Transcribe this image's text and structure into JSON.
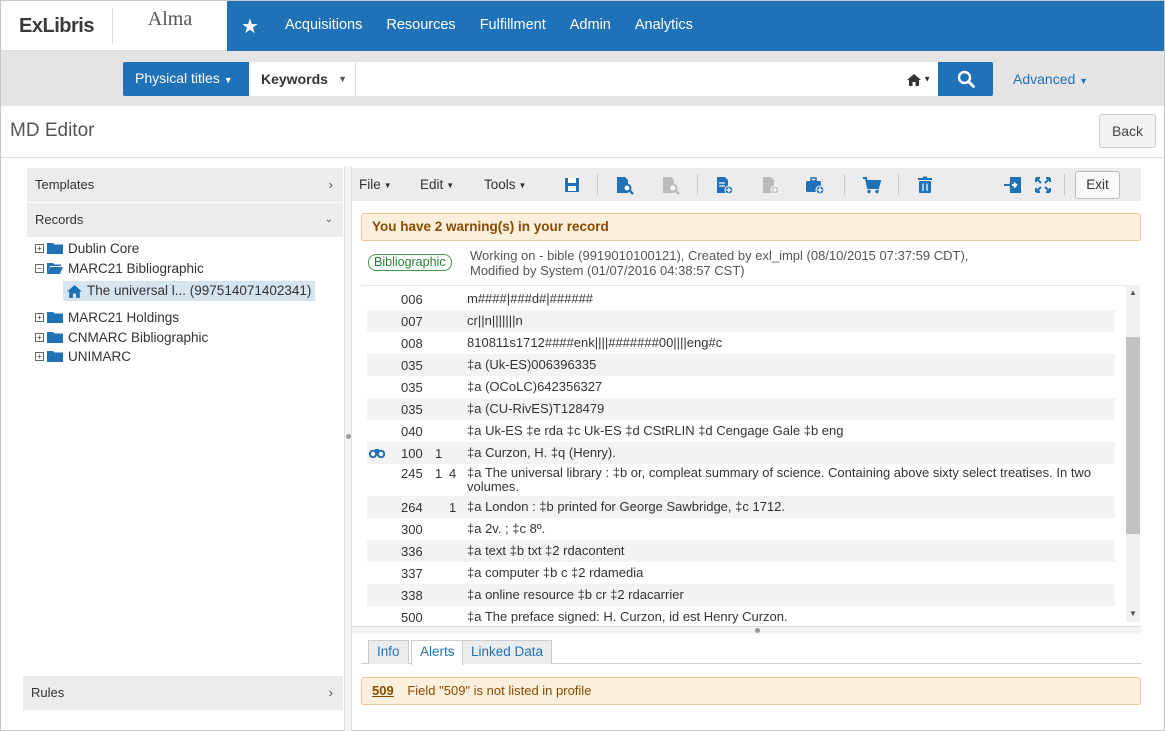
{
  "brand": {
    "company": "ExLibris",
    "product": "Alma"
  },
  "nav": {
    "items": [
      "Acquisitions",
      "Resources",
      "Fulfillment",
      "Admin",
      "Analytics"
    ]
  },
  "search": {
    "scope": "Physical titles",
    "field": "Keywords",
    "value": "",
    "advanced": "Advanced"
  },
  "page": {
    "title": "MD Editor",
    "back": "Back"
  },
  "left": {
    "templates": "Templates",
    "records": "Records",
    "rules": "Rules",
    "tree": {
      "dublin": "Dublin Core",
      "marc21bib": "MARC21 Bibliographic",
      "record": "The universal l... (997514071402341)",
      "holdings": "MARC21 Holdings",
      "cnmarc": "CNMARC Bibliographic",
      "unimarc": "UNIMARC"
    }
  },
  "toolbar": {
    "file": "File",
    "edit": "Edit",
    "tools": "Tools",
    "exit": "Exit"
  },
  "warning": "You have 2 warning(s) in your record",
  "record_info": {
    "badge": "Bibliographic",
    "line1": "Working on - bible (9919010100121), Created by exl_impl (08/10/2015 07:37:59 CDT),",
    "line2": "Modified by System (01/07/2016 04:38:57 CST)"
  },
  "marc": [
    {
      "tag": "006",
      "i1": "",
      "i2": "",
      "value": "m####|###d#|######"
    },
    {
      "tag": "007",
      "i1": "",
      "i2": "",
      "value": "cr||n|||||||n"
    },
    {
      "tag": "008",
      "i1": "",
      "i2": "",
      "value": "810811s1712####enk||||#######00||||eng#c"
    },
    {
      "tag": "035",
      "i1": "",
      "i2": "",
      "value": "‡a (Uk-ES)006396335"
    },
    {
      "tag": "035",
      "i1": "",
      "i2": "",
      "value": "‡a (OCoLC)642356327"
    },
    {
      "tag": "035",
      "i1": "",
      "i2": "",
      "value": "‡a (CU-RivES)T128479"
    },
    {
      "tag": "040",
      "i1": "",
      "i2": "",
      "value": "‡a Uk-ES ‡e rda ‡c Uk-ES ‡d CStRLIN ‡d Cengage Gale ‡b eng"
    },
    {
      "tag": "100",
      "i1": "1",
      "i2": "",
      "value": "‡a Curzon, H. ‡q (Henry)."
    },
    {
      "tag": "245",
      "i1": "1",
      "i2": "4",
      "value": "‡a The universal library : ‡b or, compleat summary of science. Containing above sixty select treatises. In two volumes."
    },
    {
      "tag": "264",
      "i1": "",
      "i2": "1",
      "value": "‡a London : ‡b printed for George Sawbridge, ‡c 1712."
    },
    {
      "tag": "300",
      "i1": "",
      "i2": "",
      "value": "‡a 2v. ; ‡c 8º."
    },
    {
      "tag": "336",
      "i1": "",
      "i2": "",
      "value": "‡a text ‡b txt ‡2 rdacontent"
    },
    {
      "tag": "337",
      "i1": "",
      "i2": "",
      "value": "‡a computer ‡b c ‡2 rdamedia"
    },
    {
      "tag": "338",
      "i1": "",
      "i2": "",
      "value": "‡a online resource ‡b cr ‡2 rdacarrier"
    },
    {
      "tag": "500",
      "i1": "",
      "i2": "",
      "value": "‡a The preface signed: H. Curzon, id est Henry Curzon."
    }
  ],
  "tabs": [
    "Info",
    "Alerts",
    "Linked Data"
  ],
  "alert": {
    "code": "509",
    "message": "Field \"509\" is not listed in profile"
  },
  "colors": {
    "brand_blue": "#1f71b8",
    "warning_bg": "#fcefdc",
    "badge_green": "#3e9a48"
  },
  "icons": {
    "star": "star-icon",
    "search": "magnifier-icon",
    "home": "home-icon",
    "binoculars": "binoculars-icon"
  }
}
